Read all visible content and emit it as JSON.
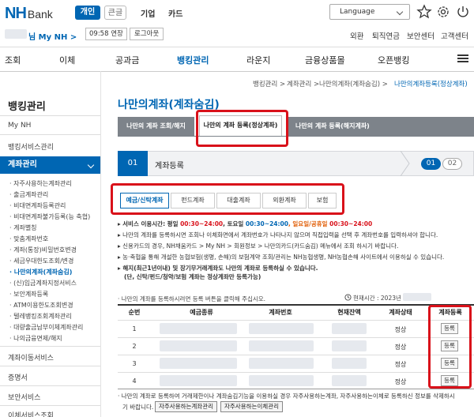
{
  "header": {
    "logo_nh": "NH",
    "logo_bank": "Bank",
    "segment_personal": "개인",
    "segment_small": "큰글",
    "link_corporate": "기업",
    "link_card": "카드",
    "language": "Language"
  },
  "session": {
    "name_suffix": "님 My NH >",
    "timer": "09:58 연장",
    "logout": "로그아웃"
  },
  "util_links": [
    "외환",
    "퇴직연금",
    "보안센터",
    "고객센터"
  ],
  "nav": [
    "조회",
    "이체",
    "공과금",
    "뱅킹관리",
    "라운지",
    "금융상품몰",
    "오픈뱅킹"
  ],
  "breadcrumb": [
    "뱅킹관리",
    "계좌관리",
    "나만의계좌(계좌숨김)",
    "나만의계좌등록(정상계좌)"
  ],
  "sidebar": {
    "title": "뱅킹관리",
    "items": [
      "My NH",
      "뱅킹서비스관리"
    ],
    "active": "계좌관리",
    "subitems": [
      "자주사용하는계좌관리",
      "출금계좌관리",
      "비대면계좌등록관리",
      "비대면계좌불가등록(능 축협)",
      "계좌별칭",
      "맞춤계좌번호",
      "계좌(통장)비밀번호변경",
      "세금우대한도조회/변경",
      "나만의계좌(계좌숨김)",
      "(신)입금계좌지정서비스",
      "보안계좌등록",
      "ATM이용한도조회변경",
      "텔레뱅킹조회계좌관리",
      "대량출금납부이체계좌관리",
      "나의금융면제/해지"
    ],
    "bottom_items": [
      "계좌이동서비스",
      "증명서",
      "보안서비스",
      "이체서비스조회"
    ]
  },
  "main": {
    "title": "나만의계좌(계좌숨김)",
    "tabs": [
      "나만의 계좌 조회/해지",
      "나만의 계좌 등록(정상계좌)",
      "나만의 계좌 등록(해지계좌)"
    ],
    "step_number": "01",
    "step_label": "계좌등록",
    "step_current": "01",
    "step_next": "02",
    "subtabs": [
      "예금/신탁계좌",
      "펀드계좌",
      "대출계좌",
      "외환계좌",
      "보험"
    ],
    "service_hours": {
      "prefix": "서비스 이용시간: 평일 ",
      "weekday": "00:30~24:00",
      "sat_label": ", 토요일 ",
      "sat": "00:30~24:00",
      "hol_label": ", 일요일/공휴일 ",
      "hol": "00:30~24:00"
    },
    "notices": [
      "나만의 계좌를 등록하시면 조회나 이체화면에서 계좌번호가 나타나지 않으며 직접입력을 선택 후 계좌번호를 입력하셔야 합니다.",
      "신용카드의 경우, NH채움카드 > My NH > 회원정보 > 나만의카드(카드숨김) 메뉴에서 조회 하시기 바랍니다.",
      "농·축협을 통해 개설한 농협보험(생명, 손해)의 보험계약 조회/관리는 NH농협생명, NH농협손해 사이트에서 이용하실 수 있습니다."
    ],
    "warning_line1": "해지(최근1년이내) 및 장기무거래계좌도 나만의 계좌로 등록하실 수 있습니다.",
    "warning_line2": "(단, 신탁/펀드/청약/보험 계좌는 정상계좌만 등록가능)",
    "table_note": "나만의 계좌를 등록하시려면 등록 버튼을 클릭해 주십시오.",
    "current_time": "현재시간 : 2023년",
    "columns": [
      "순번",
      "예금종류",
      "계좌번호",
      "현재잔액",
      "계좌상태",
      "계좌등록"
    ],
    "rows": [
      {
        "no": "1",
        "status": "정상",
        "action": "등록"
      },
      {
        "no": "2",
        "status": "정상",
        "action": "등록"
      },
      {
        "no": "3",
        "status": "정상",
        "action": "등록"
      },
      {
        "no": "4",
        "status": "정상",
        "action": "등록"
      }
    ],
    "bottom_note1": "나만의 계좌로 등록하여 거래제한이나 계좌숨김기능을 이용하실 경우 자주사용하는계좌, 자주사용하는이체로 등록하신 정보를 삭제하시",
    "bottom_note2": "기 바랍니다.",
    "bottom_btn1": "자주사용하는계좌관리",
    "bottom_btn2": "자주사용하는이체관리"
  }
}
